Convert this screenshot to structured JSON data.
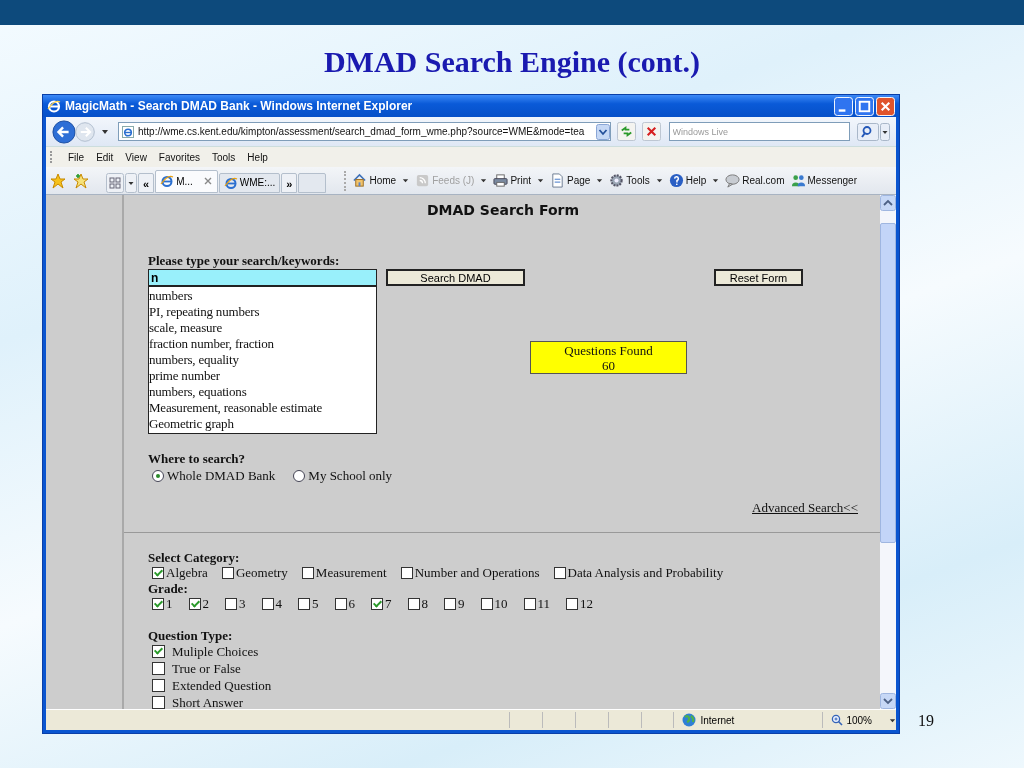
{
  "slide": {
    "title": "DMAD Search Engine (cont.)",
    "page_number": "19"
  },
  "browser": {
    "title": "MagicMath - Search DMAD Bank - Windows Internet Explorer",
    "address": "http://wme.cs.kent.edu/kimpton/assessment/search_dmad_form_wme.php?source=WME&mode=tea",
    "search_placeholder": "Windows Live",
    "menu": [
      "File",
      "Edit",
      "View",
      "Favorites",
      "Tools",
      "Help"
    ],
    "tab_scroll_left": "«",
    "tab_scroll_right": "»",
    "tabs": [
      {
        "label": "M...",
        "selected": true
      },
      {
        "label": "WME:...",
        "selected": false
      }
    ],
    "toolbar": [
      {
        "kind": "home",
        "label": "Home",
        "disabled": false,
        "dropdown": true
      },
      {
        "kind": "feeds",
        "label": "Feeds (J)",
        "disabled": true,
        "dropdown": true
      },
      {
        "kind": "print",
        "label": "Print",
        "disabled": false,
        "dropdown": true
      },
      {
        "kind": "page",
        "label": "Page",
        "disabled": false,
        "dropdown": true
      },
      {
        "kind": "tools",
        "label": "Tools",
        "disabled": false,
        "dropdown": true
      },
      {
        "kind": "help",
        "label": "Help",
        "disabled": false,
        "dropdown": true
      },
      {
        "kind": "real",
        "label": "Real.com",
        "disabled": false,
        "dropdown": false
      },
      {
        "kind": "messenger",
        "label": "Messenger",
        "disabled": false,
        "dropdown": false
      }
    ],
    "status": {
      "zone": "Internet",
      "zoom": "100%"
    }
  },
  "form": {
    "heading": "DMAD Search Form",
    "keyword_label": "Please type your search/keywords:",
    "keyword_value": "n",
    "search_button": "Search DMAD",
    "reset_button": "Reset Form",
    "suggestions": [
      "numbers",
      "PI, repeating numbers",
      "scale, measure",
      "fraction number, fraction",
      "numbers, equality",
      "prime number",
      "numbers, equations",
      "Measurement, reasonable estimate",
      "Geometric graph"
    ],
    "results": {
      "label": "Questions Found",
      "count": "60"
    },
    "where_label": "Where to search?",
    "where_options": [
      {
        "label": "Whole DMAD Bank",
        "selected": true
      },
      {
        "label": "My School only",
        "selected": false
      }
    ],
    "advanced_link": "Advanced Search<<",
    "category_label": "Select Category:",
    "categories": [
      {
        "label": "Algebra",
        "checked": true
      },
      {
        "label": "Geometry",
        "checked": false
      },
      {
        "label": "Measurement",
        "checked": false
      },
      {
        "label": "Number and Operations",
        "checked": false
      },
      {
        "label": "Data Analysis and Probability",
        "checked": false
      }
    ],
    "grade_label": "Grade:",
    "grades": [
      {
        "label": "1",
        "checked": true
      },
      {
        "label": "2",
        "checked": true
      },
      {
        "label": "3",
        "checked": false
      },
      {
        "label": "4",
        "checked": false
      },
      {
        "label": "5",
        "checked": false
      },
      {
        "label": "6",
        "checked": false
      },
      {
        "label": "7",
        "checked": true
      },
      {
        "label": "8",
        "checked": false
      },
      {
        "label": "9",
        "checked": false
      },
      {
        "label": "10",
        "checked": false
      },
      {
        "label": "11",
        "checked": false
      },
      {
        "label": "12",
        "checked": false
      }
    ],
    "type_label": "Question Type:",
    "question_types": [
      {
        "label": "Muliple Choices",
        "checked": true
      },
      {
        "label": "True or False",
        "checked": false
      },
      {
        "label": "Extended Question",
        "checked": false
      },
      {
        "label": "Short Answer",
        "checked": false
      }
    ]
  }
}
